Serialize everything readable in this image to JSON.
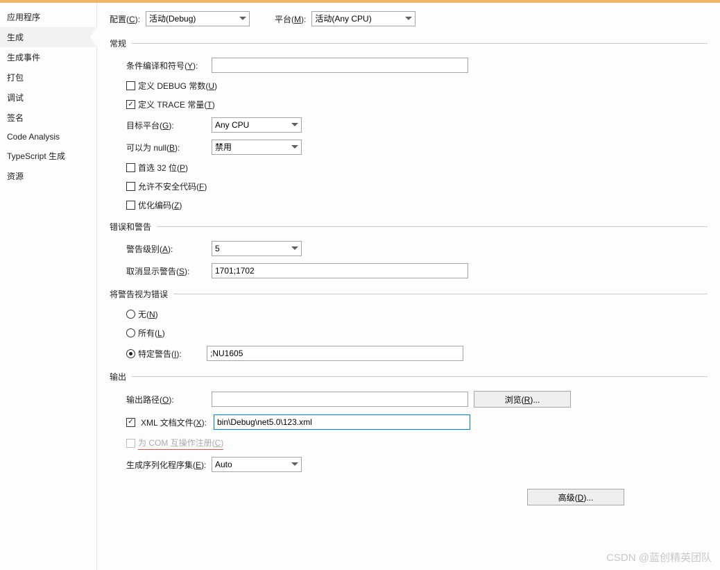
{
  "sidebar": {
    "items": [
      "应用程序",
      "生成",
      "生成事件",
      "打包",
      "调试",
      "签名",
      "Code Analysis",
      "TypeScript 生成",
      "资源"
    ],
    "selected_index": 1
  },
  "top": {
    "config_label_pre": "配置(",
    "config_label_key": "C",
    "config_label_post": "):",
    "config_value": "活动(Debug)",
    "platform_label_pre": "平台(",
    "platform_label_key": "M",
    "platform_label_post": "):",
    "platform_value": "活动(Any CPU)"
  },
  "general": {
    "title": "常规",
    "cond_label_pre": "条件编译和符号(",
    "cond_label_key": "Y",
    "cond_label_post": "):",
    "cond_value": "",
    "debug_const_pre": "定义 DEBUG 常数(",
    "debug_const_key": "U",
    "debug_const_post": ")",
    "debug_checked": false,
    "trace_const_pre": "定义 TRACE 常量(",
    "trace_const_key": "T",
    "trace_const_post": ")",
    "trace_checked": true,
    "target_label_pre": "目标平台(",
    "target_label_key": "G",
    "target_label_post": "):",
    "target_value": "Any CPU",
    "nullable_label_pre": "可以为 null(",
    "nullable_label_key": "B",
    "nullable_label_post": "):",
    "nullable_value": "禁用",
    "prefer32_pre": "首选 32 位(",
    "prefer32_key": "P",
    "prefer32_post": ")",
    "prefer32_checked": false,
    "unsafe_pre": "允许不安全代码(",
    "unsafe_key": "F",
    "unsafe_post": ")",
    "unsafe_checked": false,
    "optimize_pre": "优化编码(",
    "optimize_key": "Z",
    "optimize_post": ")",
    "optimize_checked": false
  },
  "errors": {
    "title": "错误和警告",
    "warn_level_pre": "警告级别(",
    "warn_level_key": "A",
    "warn_level_post": "):",
    "warn_level_value": "5",
    "suppress_pre": "取消显示警告(",
    "suppress_key": "S",
    "suppress_post": "):",
    "suppress_value": "1701;1702"
  },
  "warn_as_err": {
    "title": "将警告视为错误",
    "none_pre": "无(",
    "none_key": "N",
    "none_post": ")",
    "all_pre": "所有(",
    "all_key": "L",
    "all_post": ")",
    "specific_pre": "特定警告(",
    "specific_key": "I",
    "specific_post": "):",
    "specific_value": ";NU1605",
    "selected": "specific"
  },
  "output": {
    "title": "输出",
    "path_label_pre": "输出路径(",
    "path_label_key": "O",
    "path_label_post": "):",
    "path_value": "",
    "browse_pre": "浏览(",
    "browse_key": "R",
    "browse_post": ")...",
    "xml_pre": "XML 文档文件(",
    "xml_key": "X",
    "xml_post": "):",
    "xml_checked": true,
    "xml_value": "bin\\Debug\\net5.0\\123.xml",
    "com_pre": "为 COM 互操作注册(",
    "com_key": "C",
    "com_post": ")",
    "com_enabled": false,
    "serial_pre": "生成序列化程序集(",
    "serial_key": "E",
    "serial_post": "):",
    "serial_value": "Auto"
  },
  "advanced": {
    "label_pre": "高级(",
    "label_key": "D",
    "label_post": ")..."
  },
  "watermark": "CSDN @蓝创精英团队"
}
